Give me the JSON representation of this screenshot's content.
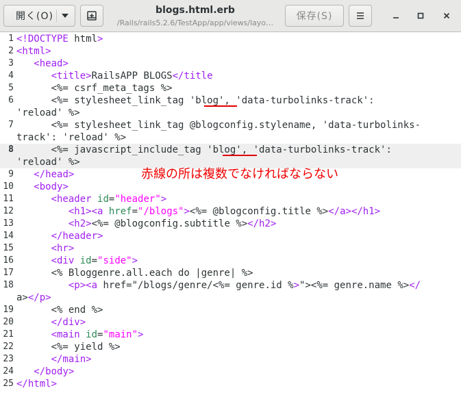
{
  "header": {
    "open_label": "開く(O)",
    "save_label": "保存(S)",
    "title": "blogs.html.erb",
    "subtitle": "/Rails/rails5.2.6/TestApp/app/views/layo…",
    "min_icon": "minimize-icon",
    "max_icon": "maximize-icon",
    "close_icon": "close-icon"
  },
  "editor": {
    "current_line": 8,
    "annotation": "赤線の所は複数でなければならない",
    "lines": [
      {
        "n": "1",
        "rows": [
          "<!DOCTYPE html>"
        ]
      },
      {
        "n": "2",
        "rows": [
          "<html>"
        ]
      },
      {
        "n": "3",
        "rows": [
          "   <head>"
        ]
      },
      {
        "n": "4",
        "rows": [
          "      <title>RailsAPP BLOGS</title"
        ]
      },
      {
        "n": "5",
        "rows": [
          "      <%= csrf_meta_tags %>"
        ]
      },
      {
        "n": "6",
        "rows": [
          "      <%= stylesheet_link_tag 'blog', 'data-turbolinks-track':",
          "'reload' %>"
        ]
      },
      {
        "n": "7",
        "rows": [
          "      <%= stylesheet_link_tag @blogconfig.stylename, 'data-turbolinks-",
          "track': 'reload' %>"
        ]
      },
      {
        "n": "8",
        "rows": [
          "      <%= javascript_include_tag 'blog', 'data-turbolinks-track':",
          "'reload' %>"
        ]
      },
      {
        "n": "9",
        "rows": [
          "   </head>"
        ]
      },
      {
        "n": "10",
        "rows": [
          "   <body>"
        ]
      },
      {
        "n": "11",
        "rows": [
          "      <header id=\"header\">"
        ]
      },
      {
        "n": "12",
        "rows": [
          "         <h1><a href=\"/blogs\"><%= @blogconfig.title %></a></h1>"
        ]
      },
      {
        "n": "13",
        "rows": [
          "         <h2><%= @blogconfig.subtitle %></h2>"
        ]
      },
      {
        "n": "14",
        "rows": [
          "      </header>"
        ]
      },
      {
        "n": "15",
        "rows": [
          "      <hr>"
        ]
      },
      {
        "n": "16",
        "rows": [
          "      <div id=\"side\">"
        ]
      },
      {
        "n": "17",
        "rows": [
          "      <% Bloggenre.all.each do |genre| %>"
        ]
      },
      {
        "n": "18",
        "rows": [
          "         <p><a href=\"/blogs/genre/<%= genre.id %>\"><%= genre.name %></",
          "a></p>"
        ]
      },
      {
        "n": "19",
        "rows": [
          "      <% end %>"
        ]
      },
      {
        "n": "20",
        "rows": [
          "      </div>"
        ]
      },
      {
        "n": "21",
        "rows": [
          "      <main id=\"main\">"
        ]
      },
      {
        "n": "22",
        "rows": [
          "      <%= yield %>"
        ]
      },
      {
        "n": "23",
        "rows": [
          "      </main>"
        ]
      },
      {
        "n": "24",
        "rows": [
          "   </body>"
        ]
      },
      {
        "n": "25",
        "rows": [
          "</html>"
        ]
      }
    ]
  }
}
